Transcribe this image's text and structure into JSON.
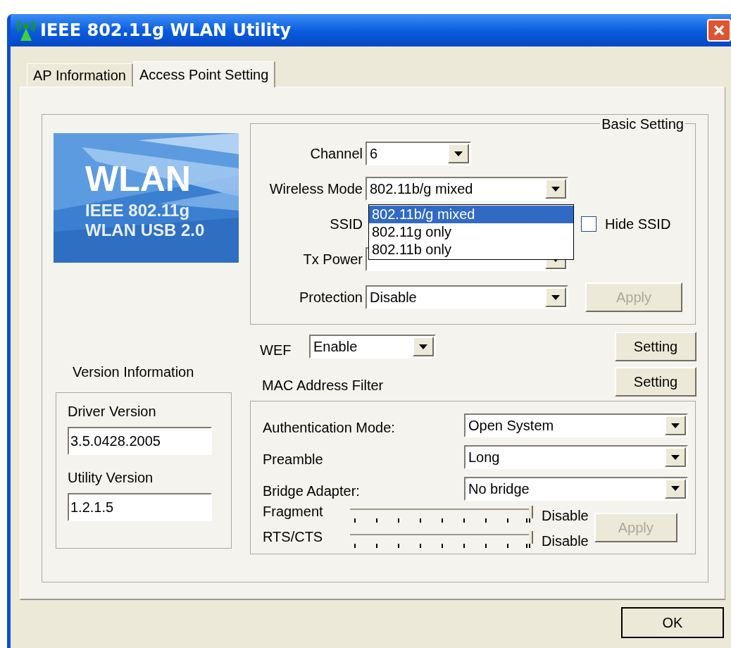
{
  "window": {
    "title": "IEEE 802.11g WLAN Utility"
  },
  "tabs": [
    {
      "label": "AP Information",
      "selected": false
    },
    {
      "label": "Access Point Setting",
      "selected": true
    }
  ],
  "logo": {
    "lines": [
      "WLAN",
      "IEEE 802.11g",
      "WLAN USB 2.0"
    ]
  },
  "version_info": {
    "title": "Version Information",
    "fields": [
      {
        "label": "Driver Version",
        "value": "3.5.0428.2005"
      },
      {
        "label": "Utility Version",
        "value": "1.2.1.5"
      }
    ]
  },
  "basic_setting": {
    "title": "Basic Setting",
    "channel": {
      "label": "Channel",
      "value": "6"
    },
    "wireless_mode": {
      "label": "Wireless Mode",
      "value": "802.11b/g mixed",
      "expanded": true,
      "options": [
        {
          "label": "802.11b/g mixed",
          "selected": true
        },
        {
          "label": "802.11g only",
          "selected": false
        },
        {
          "label": "802.11b only",
          "selected": false
        }
      ]
    },
    "ssid": {
      "label": "SSID"
    },
    "hide_ssid": {
      "label": "Hide SSID",
      "checked": false
    },
    "tx_power": {
      "label": "Tx Power"
    },
    "protection": {
      "label": "Protection",
      "value": "Disable"
    },
    "apply": {
      "label": "Apply",
      "disabled": true
    }
  },
  "wep": {
    "label": "WEF",
    "value": "Enable",
    "button": {
      "label": "Setting",
      "disabled": false
    }
  },
  "mac_filter": {
    "label": "MAC Address Filter",
    "button": {
      "label": "Setting",
      "disabled": false
    }
  },
  "advanced": {
    "rows": [
      {
        "label": "Authentication Mode:",
        "value": "Open System"
      },
      {
        "label": "Preamble",
        "value": "Long"
      },
      {
        "label": "Bridge Adapter:",
        "value": "No bridge"
      }
    ],
    "sliders": [
      {
        "label": "Fragment",
        "level": 1,
        "reading": "Disable"
      },
      {
        "label": "RTS/CTS",
        "level": 1,
        "reading": "Disable"
      }
    ],
    "apply": {
      "label": "Apply",
      "disabled": true
    }
  },
  "buttons": [
    {
      "label": "OK",
      "disabled": false
    }
  ]
}
